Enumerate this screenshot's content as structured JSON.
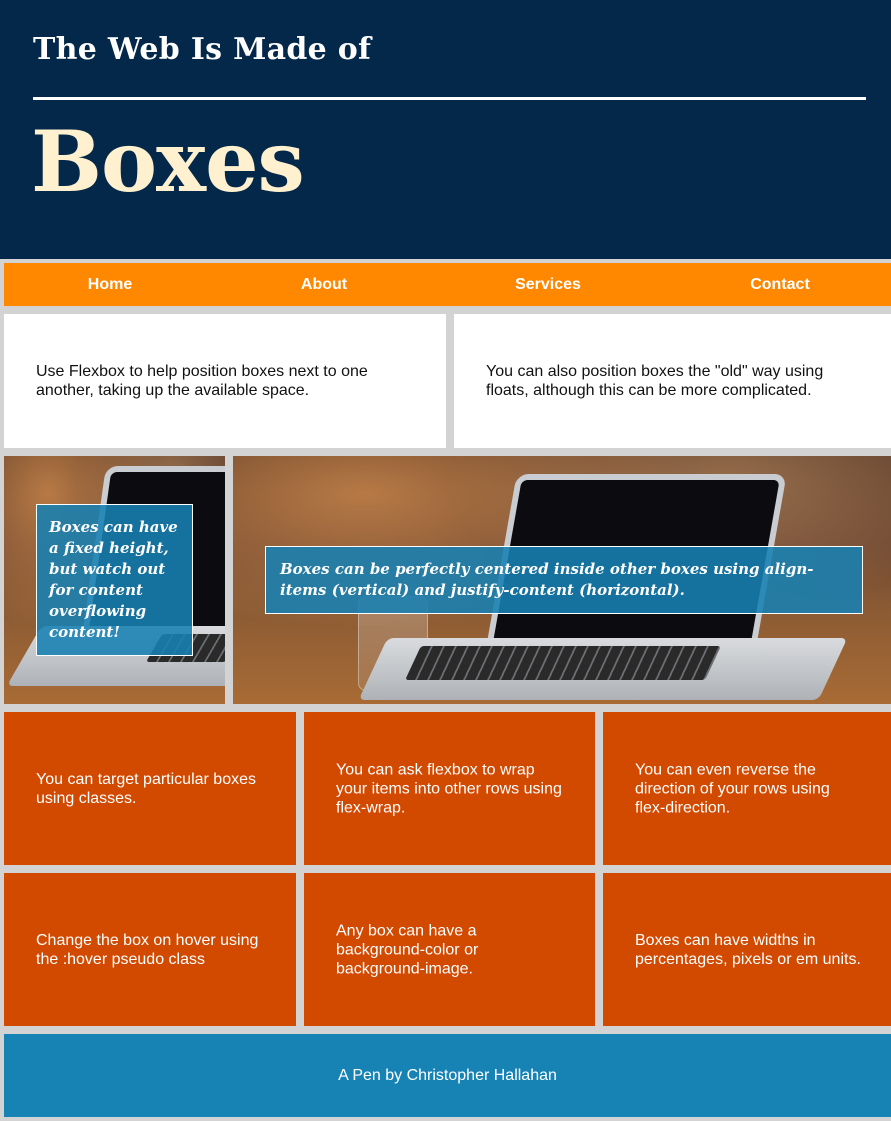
{
  "header": {
    "kicker": "The Web Is Made of",
    "title": "Boxes"
  },
  "nav": {
    "items": [
      {
        "label": "Home"
      },
      {
        "label": "About"
      },
      {
        "label": "Services"
      },
      {
        "label": "Contact"
      }
    ]
  },
  "intro": [
    "Use Flexbox to help position boxes next to one another, taking up the available space.",
    "You can also position boxes the \"old\" way using floats, although this can be more complicated."
  ],
  "images": {
    "left_caption": "Boxes can have a fixed height, but watch out for content overflowing content!",
    "right_caption": "Boxes can be perfectly centered inside other boxes using align-items (vertical) and justify-content (horizontal)."
  },
  "tiles": [
    "You can target particular boxes using classes.",
    "You can ask flexbox to wrap your items into other rows using flex-wrap.",
    "You can even reverse the direction of your rows using flex-direction.",
    "Change the box on hover using the :hover pseudo class",
    "Any box can have a background-color or background-image.",
    "Boxes can have widths in percentages, pixels or em units."
  ],
  "footer": {
    "text": "A Pen by Christopher Hallahan"
  },
  "colors": {
    "header_bg": "#03284a",
    "title_color": "#fff1cf",
    "nav_bg": "#ff8800",
    "tile_bg": "#d24900",
    "footer_bg": "#1783b5",
    "page_bg": "#d3d3d3"
  }
}
